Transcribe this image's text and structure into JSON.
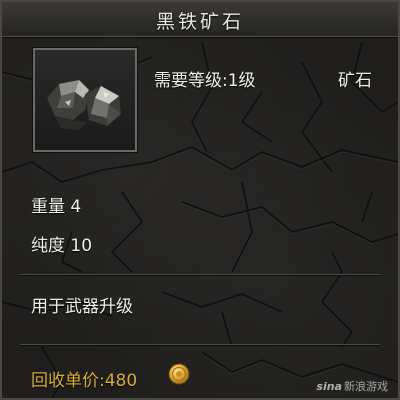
{
  "item": {
    "name": "黑铁矿石",
    "required_level": "需要等级:1级",
    "type": "矿石",
    "icon": "ore-icon",
    "weight": "重量 4",
    "purity": "纯度 10",
    "description": "用于武器升级",
    "sell_price": "回收单价:480",
    "currency_icon": "gold-coin-icon"
  },
  "watermark": {
    "brand": "sina",
    "text": "新浪游戏"
  },
  "colors": {
    "price": "#d7ad3c",
    "text": "#f0efe8",
    "background": "#1f1e1c"
  }
}
